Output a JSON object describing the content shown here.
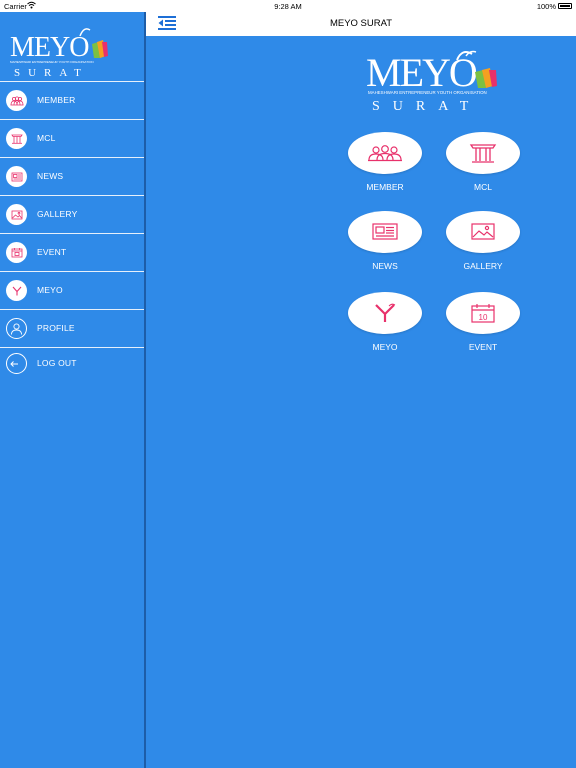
{
  "status_bar": {
    "carrier": "Carrier",
    "time": "9:28 AM",
    "battery": "100%"
  },
  "navbar": {
    "title": "MEYO SURAT"
  },
  "logo": {
    "wordmark": "MEYO",
    "tagline": "MAHESHWARI ENTREPRENEUR YOUTH ORGANISATION",
    "city": "SURAT"
  },
  "sidebar": {
    "items": [
      {
        "label": "MEMBER",
        "icon": "members-icon"
      },
      {
        "label": "MCL",
        "icon": "pillars-icon"
      },
      {
        "label": "NEWS",
        "icon": "newspaper-icon"
      },
      {
        "label": "GALLERY",
        "icon": "picture-icon"
      },
      {
        "label": "EVENT",
        "icon": "calendar-icon"
      },
      {
        "label": "MEYO",
        "icon": "meyo-y-icon"
      },
      {
        "label": "PROFILE",
        "icon": "user-icon"
      },
      {
        "label": "LOG OUT",
        "icon": "logout-icon"
      }
    ]
  },
  "grid": {
    "tiles": [
      {
        "label": "MEMBER",
        "icon": "members-icon"
      },
      {
        "label": "MCL",
        "icon": "pillars-icon"
      },
      {
        "label": "NEWS",
        "icon": "newspaper-icon"
      },
      {
        "label": "GALLERY",
        "icon": "picture-icon"
      },
      {
        "label": "MEYO",
        "icon": "meyo-y-icon"
      },
      {
        "label": "EVENT",
        "icon": "calendar-icon",
        "day": "10"
      }
    ]
  },
  "colors": {
    "background": "#2f8ae8",
    "icon_accent": "#e8316b",
    "nav_bg": "#ffffff"
  }
}
